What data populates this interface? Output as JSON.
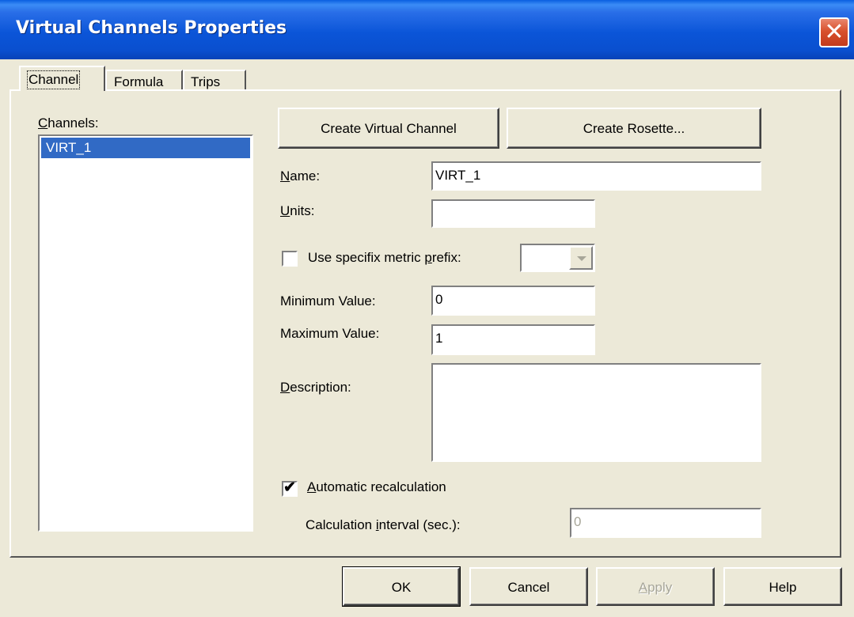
{
  "window": {
    "title": "Virtual Channels Properties",
    "close_icon": "close-icon"
  },
  "tabs": [
    {
      "label": "Channel",
      "active": true
    },
    {
      "label": "Formula",
      "active": false
    },
    {
      "label": "Trips",
      "active": false
    }
  ],
  "channels": {
    "label_pre": "",
    "label_mn": "C",
    "label_post": "hannels:",
    "items": [
      "VIRT_1"
    ],
    "selected": "VIRT_1"
  },
  "buttons": {
    "create_virtual_channel": "Create Virtual Channel",
    "create_rosette": "Create Rosette..."
  },
  "form": {
    "name": {
      "mn": "N",
      "rest": "ame:",
      "value": "VIRT_1"
    },
    "units": {
      "mn": "U",
      "rest": "nits:",
      "value": ""
    },
    "metric_prefix": {
      "pre": "Use specifix metric ",
      "mn": "p",
      "post": "refix:",
      "checked": false,
      "selected": ""
    },
    "minimum": {
      "label": "Minimum Value:",
      "value": "0"
    },
    "maximum": {
      "label": "Maximum Value:",
      "value": "1"
    },
    "description": {
      "mn": "D",
      "rest": "escription:",
      "value": ""
    },
    "auto_recalc": {
      "mn": "A",
      "rest": "utomatic recalculation",
      "checked": true
    },
    "calc_interval": {
      "pre": "Calculation ",
      "mn": "i",
      "post": "nterval (sec.):",
      "value": "0"
    }
  },
  "footer": {
    "ok": "OK",
    "cancel": "Cancel",
    "apply_mn": "A",
    "apply_rest": "pply",
    "help": "Help"
  }
}
